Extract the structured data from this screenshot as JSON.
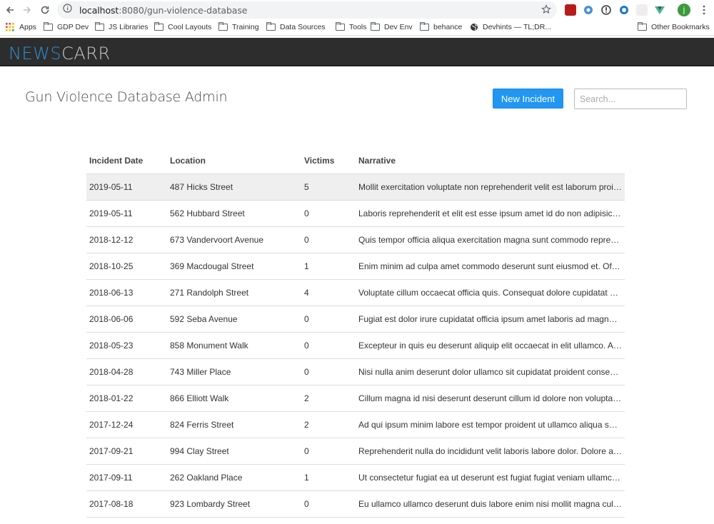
{
  "browser": {
    "url_host": "localhost",
    "url_path": ":8080/gun-violence-database",
    "bookmarks": [
      {
        "label": "Apps",
        "type": "apps"
      },
      {
        "label": "GDP Dev",
        "type": "folder"
      },
      {
        "label": "JS Libraries",
        "type": "folder"
      },
      {
        "label": "Cool Layouts",
        "type": "folder"
      },
      {
        "label": "Training",
        "type": "folder"
      },
      {
        "label": "Data Sources",
        "type": "folder"
      },
      {
        "label": "Tools",
        "type": "folder"
      },
      {
        "label": "Dev Env",
        "type": "folder"
      },
      {
        "label": "behance",
        "type": "folder"
      },
      {
        "label": "Devhints — TL;DR...",
        "type": "globe"
      },
      {
        "label": "Other Bookmarks",
        "type": "folder"
      }
    ],
    "profile_initial": "j"
  },
  "app": {
    "logo_part1": "NEWS",
    "logo_part2": "CARR",
    "page_title": "Gun Violence Database Admin",
    "new_button": "New Incident",
    "search_placeholder": "Search..."
  },
  "table": {
    "headers": [
      "Incident Date",
      "Location",
      "Victims",
      "Narrative"
    ],
    "rows": [
      [
        "2019-05-11",
        "487 Hicks Street",
        "5",
        "Mollit exercitation voluptate non reprehenderit velit est laborum proident."
      ],
      [
        "2019-05-11",
        "562 Hubbard Street",
        "0",
        "Laboris reprehenderit et elit est esse ipsum amet id do non adipisicing."
      ],
      [
        "2018-12-12",
        "673 Vandervoort Avenue",
        "0",
        "Quis tempor officia aliqua exercitation magna sunt commodo reprehenderit."
      ],
      [
        "2018-10-25",
        "369 Macdougal Street",
        "1",
        "Enim minim ad culpa amet commodo deserunt sunt eiusmod et. Officia."
      ],
      [
        "2018-06-13",
        "271 Randolph Street",
        "4",
        "Voluptate cillum occaecat officia quis. Consequat dolore cupidatat dolor."
      ],
      [
        "2018-06-06",
        "592 Seba Avenue",
        "0",
        "Fugiat est dolor irure cupidatat officia ipsum amet laboris ad magna. Occaecat."
      ],
      [
        "2018-05-23",
        "858 Monument Walk",
        "0",
        "Excepteur in quis eu deserunt aliquip elit occaecat in elit ullamco. Aliqua."
      ],
      [
        "2018-04-28",
        "743 Miller Place",
        "0",
        "Nisi nulla anim deserunt dolor ullamco sit cupidatat proident consectetur."
      ],
      [
        "2018-01-22",
        "866 Elliott Walk",
        "2",
        "Cillum magna id nisi deserunt deserunt cillum id dolore non voluptate est."
      ],
      [
        "2017-12-24",
        "824 Ferris Street",
        "2",
        "Ad qui ipsum minim labore est tempor proident ut ullamco aliqua sunt eu."
      ],
      [
        "2017-09-21",
        "994 Clay Street",
        "0",
        "Reprehenderit nulla do incididunt velit laboris labore dolor. Dolore anim."
      ],
      [
        "2017-09-11",
        "262 Oakland Place",
        "1",
        "Ut consectetur fugiat ea ut deserunt est fugiat fugiat veniam ullamco do."
      ],
      [
        "2017-08-18",
        "923 Lombardy Street",
        "0",
        "Eu ullamco ullamco deserunt duis labore enim nisi mollit magna culpa sunt."
      ]
    ]
  }
}
